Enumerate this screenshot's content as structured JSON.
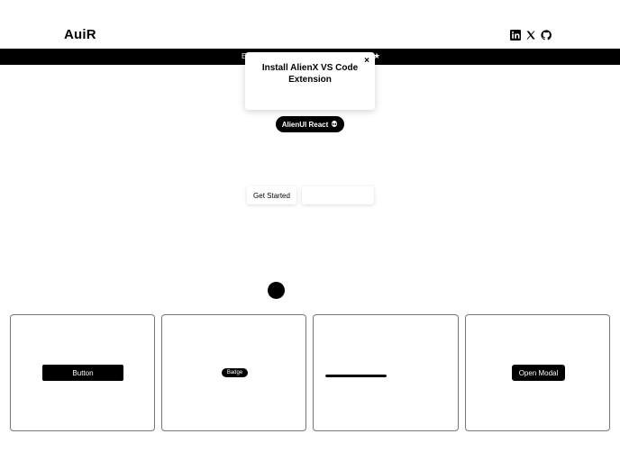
{
  "header": {
    "logo": "AuiR",
    "social_icons": [
      "linkedin-icon",
      "x-icon",
      "github-icon"
    ]
  },
  "banner": {
    "text_left": "E",
    "text_right": "★"
  },
  "popup": {
    "title": "Install AlienX VS Code Extension",
    "close_label": "×"
  },
  "hero": {
    "badge_label": "AlienUI React",
    "badge_icon": "alien-icon",
    "get_started_label": "Get Started"
  },
  "cards": {
    "button_label": "Button",
    "badge_label": "Badge",
    "progress_value": 1.0,
    "modal_label": "Open Modal"
  },
  "colors": {
    "background": "#ffffff",
    "primary": "#000000",
    "card_border": "#777777"
  }
}
